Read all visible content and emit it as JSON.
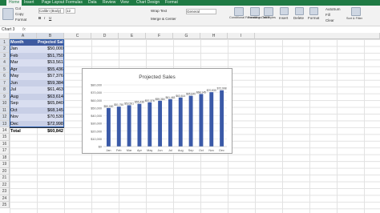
{
  "ribbon_tabs": [
    "Home",
    "Insert",
    "Page Layout",
    "Formulas",
    "Data",
    "Review",
    "View",
    "Chart Design",
    "Format"
  ],
  "ribbon": {
    "cut": "Cut",
    "copy": "Copy",
    "format": "Format",
    "font_name": "Calibri (Body)",
    "font_size": "12",
    "wrap_text": "Wrap Text",
    "merge_center": "Merge & Center",
    "number_format": "General",
    "conditional": "Conditional Formatting",
    "format_table": "Format as Table",
    "cell_styles": "Cell Styles",
    "insert": "Insert",
    "delete": "Delete",
    "format_cells": "Format",
    "autosum": "AutoSum",
    "fill": "Fill",
    "clear": "Clear",
    "sort": "Sort & Filter"
  },
  "name_box": "Chart 3",
  "fx": "fx",
  "columns": [
    "A",
    "B",
    "C",
    "D",
    "E",
    "F",
    "G",
    "H",
    "I"
  ],
  "rows": [
    "1",
    "2",
    "3",
    "4",
    "5",
    "6",
    "7",
    "8",
    "9",
    "10",
    "11",
    "12",
    "13",
    "14",
    "15",
    "16",
    "17",
    "18",
    "19",
    "20",
    "21",
    "22",
    "23",
    "24",
    "25"
  ],
  "table": {
    "header": [
      "Month",
      "Projected Sales"
    ],
    "rows": [
      [
        "Jan",
        "$50,000"
      ],
      [
        "Feb",
        "$51,750"
      ],
      [
        "Mar",
        "$53,561"
      ],
      [
        "Apr",
        "$55,436"
      ],
      [
        "May",
        "$57,376"
      ],
      [
        "Jun",
        "$59,384"
      ],
      [
        "Jul",
        "$61,463"
      ],
      [
        "Aug",
        "$63,614"
      ],
      [
        "Sep",
        "$65,840"
      ],
      [
        "Oct",
        "$68,145"
      ],
      [
        "Nov",
        "$70,530"
      ],
      [
        "Dec",
        "$72,998"
      ]
    ],
    "total_label": "Total",
    "total_value": "$60,842"
  },
  "chart_data": {
    "type": "bar",
    "title": "Projected Sales",
    "categories": [
      "Jan",
      "Feb",
      "Mar",
      "Apr",
      "May",
      "Jun",
      "Jul",
      "Aug",
      "Sep",
      "Oct",
      "Nov",
      "Dec"
    ],
    "values": [
      50000,
      51750,
      53561,
      55436,
      57376,
      59384,
      61463,
      63614,
      65840,
      68145,
      70530,
      72998
    ],
    "data_labels": [
      "$50,000",
      "$51,750",
      "$53,561",
      "$55,436",
      "$57,376",
      "$59,384",
      "$61,463",
      "$63,614",
      "$65,840",
      "$68,145",
      "$70,530",
      "$72,998"
    ],
    "yticks": [
      "$0",
      "$10,000",
      "$20,000",
      "$30,000",
      "$40,000",
      "$50,000",
      "$60,000",
      "$70,000",
      "$80,000"
    ],
    "ylim": [
      0,
      80000
    ],
    "bar_color": "#3b5aa8",
    "grid": true
  },
  "colors": {
    "excel_green": "#1f7a44",
    "header_blue": "#3e5aa0",
    "selected_fill": "#d9def0"
  }
}
